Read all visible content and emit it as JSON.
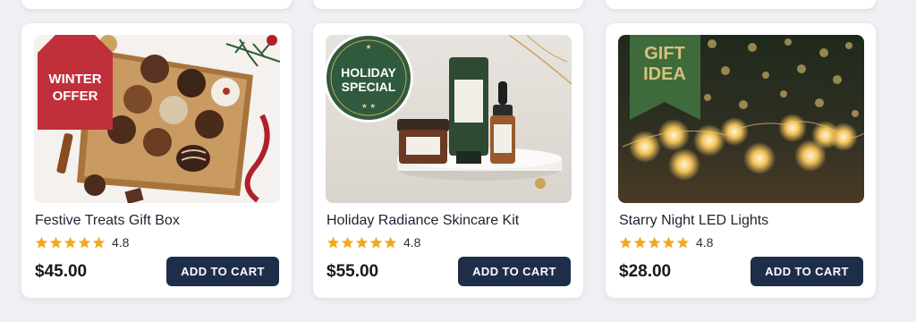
{
  "products": [
    {
      "title": "Festive Treats Gift Box",
      "rating": "4.8",
      "rating_value": 4.8,
      "price": "$45.00",
      "cart_label": "ADD TO CART",
      "badge_line1": "WINTER",
      "badge_line2": "OFFER",
      "badge_color": "#c0303a"
    },
    {
      "title": "Holiday Radiance Skincare Kit",
      "rating": "4.8",
      "rating_value": 4.8,
      "price": "$55.00",
      "cart_label": "ADD TO CART",
      "badge_line1": "HOLIDAY",
      "badge_line2": "SPECIAL",
      "badge_color": "#2f5a3e"
    },
    {
      "title": "Starry Night LED Lights",
      "rating": "4.8",
      "rating_value": 4.8,
      "price": "$28.00",
      "cart_label": "ADD TO CART",
      "badge_line1": "GIFT",
      "badge_line2": "IDEA",
      "badge_color": "#3f6b3c"
    }
  ],
  "colors": {
    "button": "#1e2d4a",
    "star": "#f2a81d",
    "background": "#eef0f3"
  },
  "icons": {
    "rating": "star-icon"
  }
}
